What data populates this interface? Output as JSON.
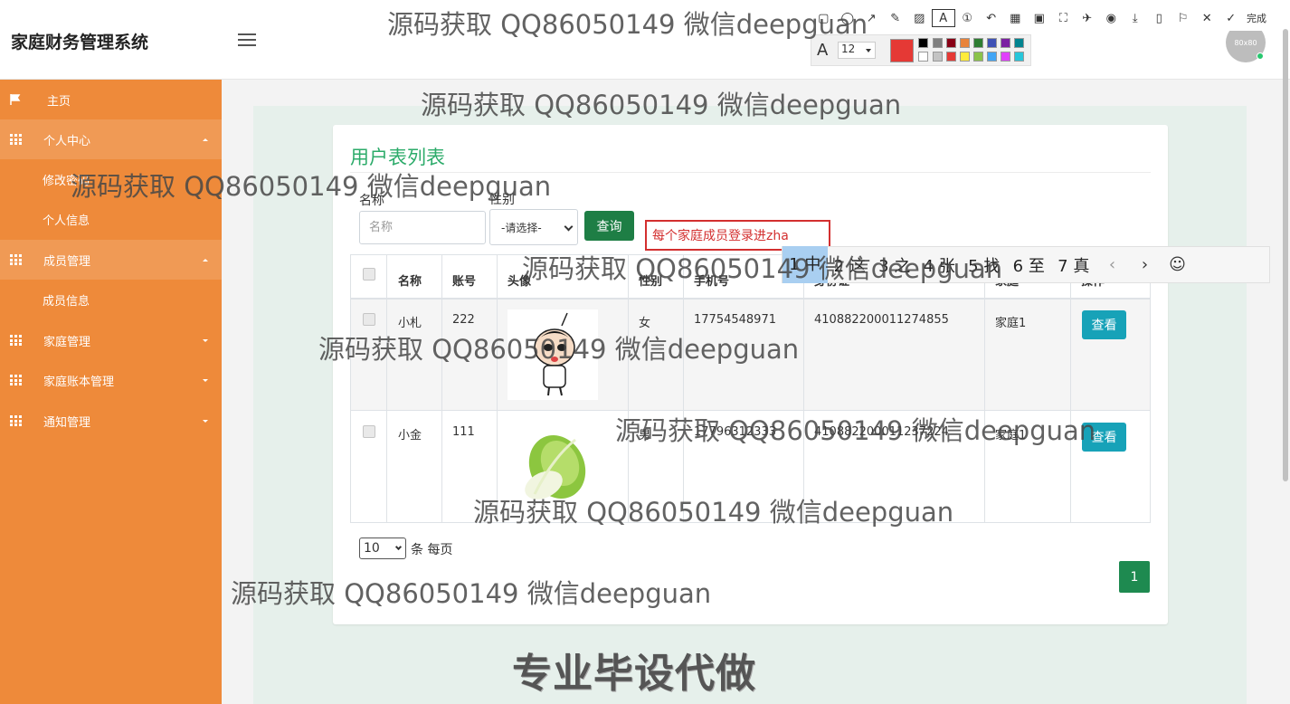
{
  "app": {
    "title": "家庭财务管理系统",
    "avatar_text": "80x80"
  },
  "sidebar": {
    "items": [
      {
        "label": "主页"
      },
      {
        "label": "个人中心",
        "sub": [
          "修改密码",
          "个人信息"
        ]
      },
      {
        "label": "成员管理",
        "sub": [
          "成员信息"
        ]
      },
      {
        "label": "家庭管理"
      },
      {
        "label": "家庭账本管理"
      },
      {
        "label": "通知管理"
      }
    ]
  },
  "page": {
    "title": "用户表列表"
  },
  "search": {
    "name_label": "名称",
    "name_placeholder": "名称",
    "gender_label": "性别",
    "gender_value": "-请选择-",
    "query_button": "查询"
  },
  "table": {
    "headers": [
      "名称",
      "账号",
      "头像",
      "性别",
      "手机号",
      "身份证",
      "家庭",
      "操作"
    ],
    "rows": [
      {
        "name": "小札",
        "account": "222",
        "gender": "女",
        "phone": "17754548971",
        "idcard": "410882200011274855",
        "family": "家庭1",
        "action": "查看"
      },
      {
        "name": "小金",
        "account": "111",
        "gender": "男",
        "phone": "17796312333",
        "idcard": "410882200011237224",
        "family": "家庭1",
        "action": "查看"
      }
    ]
  },
  "pagination": {
    "page_size": "10",
    "per_page_text": "条 每页",
    "current_page": "1"
  },
  "overlay": {
    "watermark": "源码获取 QQ86050149 微信deepguan",
    "promo": "专业毕设代做",
    "annotation_text": "每个家庭成员登录进zha",
    "font_size": "12",
    "ime_candidates": [
      "1 中",
      "2 这",
      "3 之",
      "4 张",
      "5 找",
      "6 至",
      "7 真"
    ],
    "toolbar_done": "完成"
  },
  "colors": {
    "sidebar": "#ee8a3a",
    "accent_green": "#2cab6a",
    "query_button": "#1e7e45",
    "view_button": "#17a2b8",
    "page_button": "#1e8a50"
  }
}
